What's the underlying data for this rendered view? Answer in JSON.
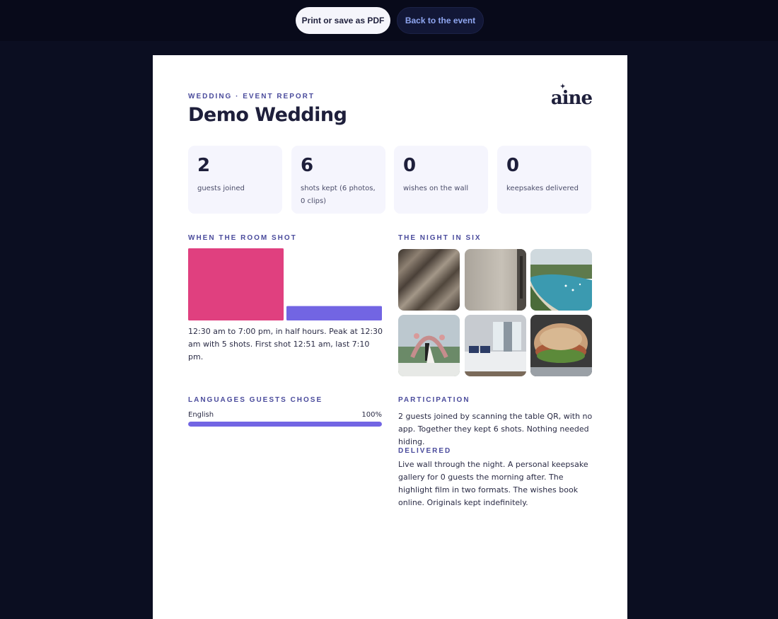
{
  "toolbar": {
    "print_label": "Print or save as PDF",
    "back_label": "Back to the event"
  },
  "report": {
    "kicker": "WEDDING · EVENT REPORT",
    "title": "Demo Wedding",
    "logo": "aine"
  },
  "stats": [
    {
      "value": "2",
      "label": "guests joined"
    },
    {
      "value": "6",
      "label": "shots kept (6 photos, 0 clips)"
    },
    {
      "value": "0",
      "label": "wishes on the wall"
    },
    {
      "value": "0",
      "label": "keepsakes delivered"
    }
  ],
  "room_shot": {
    "heading": "WHEN THE ROOM SHOT",
    "summary": "12:30 am to 7:00 pm, in half hours. Peak at 12:30 am with 5 shots. First shot 12:51 am, last 7:10 pm."
  },
  "chart_data": {
    "type": "bar",
    "categories": [
      "12:30 am",
      "7:00 pm"
    ],
    "values": [
      5,
      1
    ],
    "colors": [
      "#e0407f",
      "#7265e3"
    ],
    "ylim": [
      0,
      5
    ],
    "title": "",
    "xlabel": "",
    "ylabel": ""
  },
  "night_in_six": {
    "heading": "THE NIGHT IN SIX",
    "photos": [
      "fabric-photo",
      "wall-photo",
      "beach-photo",
      "wedding-arch-photo",
      "bedroom-photo",
      "sandwich-photo"
    ]
  },
  "languages": {
    "heading": "LANGUAGES GUESTS CHOSE",
    "items": [
      {
        "name": "English",
        "percent_label": "100%",
        "percent": 100
      }
    ]
  },
  "participation": {
    "heading": "PARTICIPATION",
    "text": "2 guests joined by scanning the table QR, with no app. Together they kept 6 shots. Nothing needed hiding."
  },
  "delivered": {
    "heading": "DELIVERED",
    "text": "Live wall through the night. A personal keepsake gallery for 0 guests the morning after. The highlight film in two formats. The wishes book online. Originals kept indefinitely."
  },
  "colors": {
    "accent": "#7265e3",
    "peak": "#e0407f",
    "heading": "#4a4b9c",
    "background": "#0b0e21"
  }
}
